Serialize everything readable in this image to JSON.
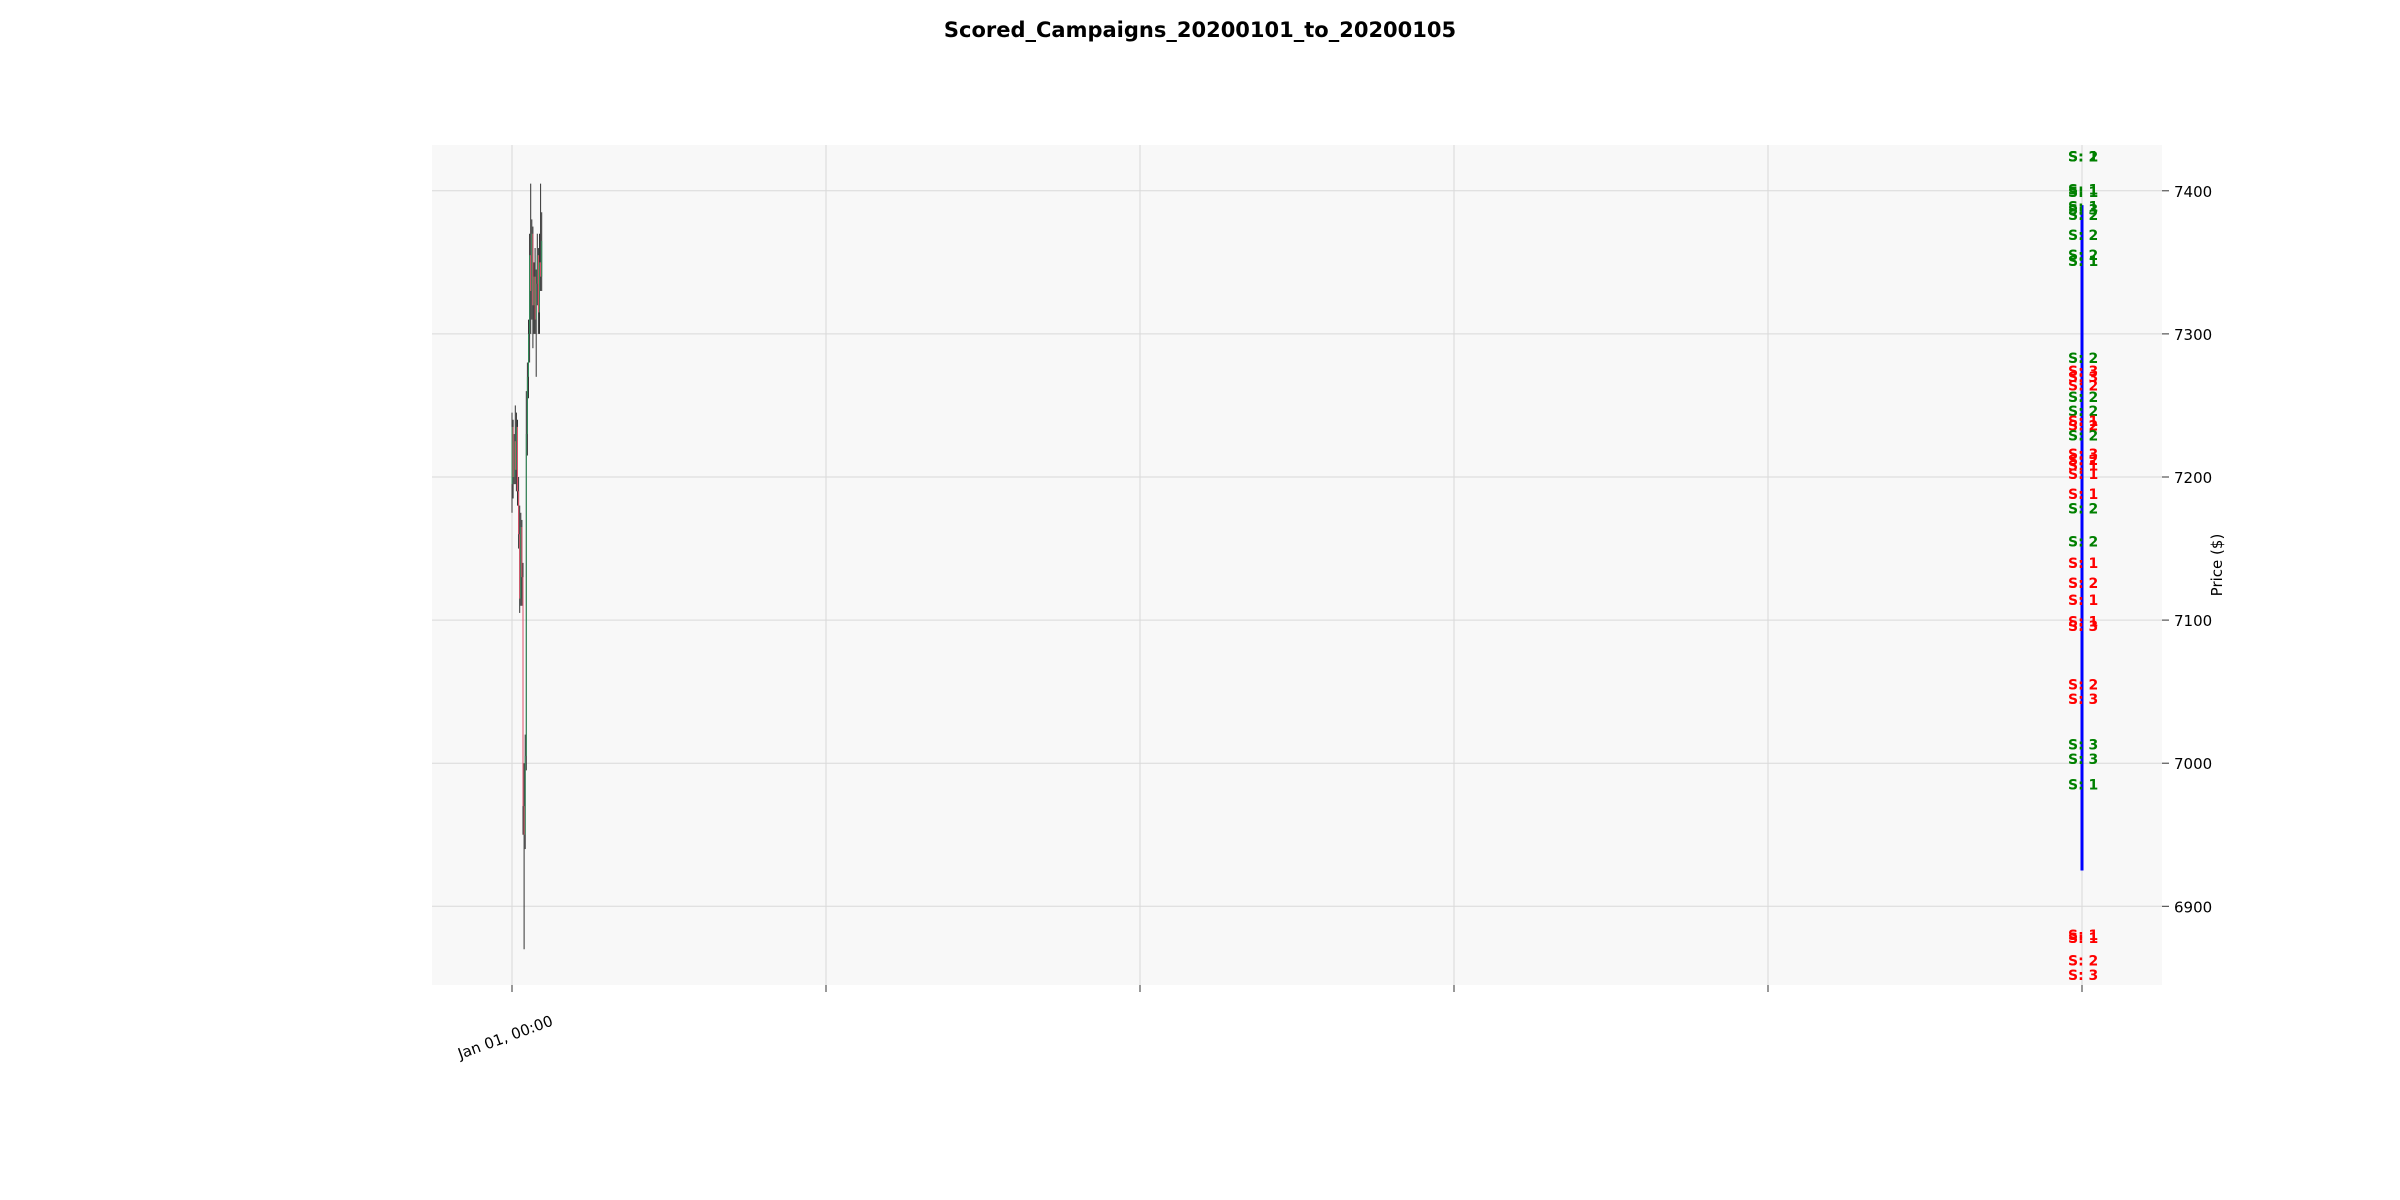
{
  "chart_data": {
    "type": "candlestick",
    "title": "Scored_Campaigns_20200101_to_20200105",
    "ylabel": "Price ($)",
    "xlabel": "",
    "x_tick_labels": [
      "Jan 01, 00:00",
      "",
      "",
      "",
      "",
      ""
    ],
    "ylim": [
      6845,
      7432
    ],
    "y_ticks": [
      6900,
      7000,
      7100,
      7200,
      7300,
      7400
    ],
    "grid": true,
    "colors": {
      "up": "#2e8b57",
      "down": "#e0506a",
      "wick": "#333333",
      "buy": "#008000",
      "sell": "#ff0000",
      "line": "#0000ff",
      "plot_bg": "#f8f8f8",
      "grid": "#d9d9d9"
    },
    "candles": [
      {
        "o": 7195,
        "h": 7245,
        "l": 7175,
        "c": 7235
      },
      {
        "o": 7235,
        "h": 7240,
        "l": 7185,
        "c": 7200
      },
      {
        "o": 7200,
        "h": 7230,
        "l": 7195,
        "c": 7225
      },
      {
        "o": 7225,
        "h": 7250,
        "l": 7195,
        "c": 7205
      },
      {
        "o": 7205,
        "h": 7245,
        "l": 7190,
        "c": 7235
      },
      {
        "o": 7235,
        "h": 7240,
        "l": 7180,
        "c": 7190
      },
      {
        "o": 7190,
        "h": 7200,
        "l": 7150,
        "c": 7160
      },
      {
        "o": 7160,
        "h": 7180,
        "l": 7105,
        "c": 7115
      },
      {
        "o": 7115,
        "h": 7175,
        "l": 7110,
        "c": 7165
      },
      {
        "o": 7165,
        "h": 7170,
        "l": 7110,
        "c": 7130
      },
      {
        "o": 7130,
        "h": 7140,
        "l": 6950,
        "c": 6970
      },
      {
        "o": 6970,
        "h": 7000,
        "l": 6870,
        "c": 6950
      },
      {
        "o": 6950,
        "h": 7020,
        "l": 6940,
        "c": 7005
      },
      {
        "o": 7005,
        "h": 7260,
        "l": 6995,
        "c": 7230
      },
      {
        "o": 7230,
        "h": 7280,
        "l": 7215,
        "c": 7270
      },
      {
        "o": 7270,
        "h": 7310,
        "l": 7255,
        "c": 7300
      },
      {
        "o": 7300,
        "h": 7370,
        "l": 7280,
        "c": 7355
      },
      {
        "o": 7355,
        "h": 7405,
        "l": 7300,
        "c": 7330
      },
      {
        "o": 7330,
        "h": 7380,
        "l": 7310,
        "c": 7370
      },
      {
        "o": 7370,
        "h": 7375,
        "l": 7290,
        "c": 7320
      },
      {
        "o": 7320,
        "h": 7350,
        "l": 7300,
        "c": 7340
      },
      {
        "o": 7340,
        "h": 7360,
        "l": 7300,
        "c": 7310
      },
      {
        "o": 7310,
        "h": 7345,
        "l": 7270,
        "c": 7335
      },
      {
        "o": 7335,
        "h": 7370,
        "l": 7320,
        "c": 7355
      },
      {
        "o": 7355,
        "h": 7360,
        "l": 7300,
        "c": 7315
      },
      {
        "o": 7315,
        "h": 7370,
        "l": 7300,
        "c": 7350
      },
      {
        "o": 7350,
        "h": 7405,
        "l": 7330,
        "c": 7340
      },
      {
        "o": 7340,
        "h": 7385,
        "l": 7330,
        "c": 7365
      }
    ],
    "vertical_line": {
      "from": 6925,
      "to": 7390
    },
    "labels": [
      {
        "text": "S: 2",
        "price": 7424,
        "side": "buy"
      },
      {
        "text": "S: 1",
        "price": 7424,
        "side": "buy"
      },
      {
        "text": "S: 1",
        "price": 7401,
        "side": "buy"
      },
      {
        "text": "S: 1",
        "price": 7399,
        "side": "buy"
      },
      {
        "text": "S: 1",
        "price": 7389,
        "side": "buy"
      },
      {
        "text": "S: 3",
        "price": 7387,
        "side": "buy"
      },
      {
        "text": "S: 2",
        "price": 7383,
        "side": "buy"
      },
      {
        "text": "S: 2",
        "price": 7369,
        "side": "buy"
      },
      {
        "text": "S: 2",
        "price": 7355,
        "side": "buy"
      },
      {
        "text": "S: 1",
        "price": 7351,
        "side": "buy"
      },
      {
        "text": "S: 2",
        "price": 7283,
        "side": "buy"
      },
      {
        "text": "S: 3",
        "price": 7274,
        "side": "sell"
      },
      {
        "text": "S: 3",
        "price": 7270,
        "side": "sell"
      },
      {
        "text": "S: 2",
        "price": 7264,
        "side": "sell"
      },
      {
        "text": "S: 2",
        "price": 7256,
        "side": "buy"
      },
      {
        "text": "S: 2",
        "price": 7246,
        "side": "buy"
      },
      {
        "text": "S: 1",
        "price": 7239,
        "side": "sell"
      },
      {
        "text": "S: 2",
        "price": 7236,
        "side": "sell"
      },
      {
        "text": "S: 2",
        "price": 7229,
        "side": "buy"
      },
      {
        "text": "S: 3",
        "price": 7216,
        "side": "sell"
      },
      {
        "text": "S: 2",
        "price": 7212,
        "side": "sell"
      },
      {
        "text": "S: 1",
        "price": 7208,
        "side": "sell"
      },
      {
        "text": "S: 1",
        "price": 7202,
        "side": "sell"
      },
      {
        "text": "S: 1",
        "price": 7188,
        "side": "sell"
      },
      {
        "text": "S: 2",
        "price": 7178,
        "side": "buy"
      },
      {
        "text": "S: 2",
        "price": 7155,
        "side": "buy"
      },
      {
        "text": "S: 1",
        "price": 7140,
        "side": "sell"
      },
      {
        "text": "S: 2",
        "price": 7126,
        "side": "sell"
      },
      {
        "text": "S: 1",
        "price": 7099,
        "side": "sell"
      },
      {
        "text": "S: 3",
        "price": 7096,
        "side": "sell"
      },
      {
        "text": "S: 1",
        "price": 7114,
        "side": "sell"
      },
      {
        "text": "S: 2",
        "price": 7055,
        "side": "sell"
      },
      {
        "text": "S: 3",
        "price": 7045,
        "side": "sell"
      },
      {
        "text": "S: 3",
        "price": 7013,
        "side": "buy"
      },
      {
        "text": "S: 3",
        "price": 7003,
        "side": "buy"
      },
      {
        "text": "S: 1",
        "price": 6985,
        "side": "buy"
      },
      {
        "text": "S: 1",
        "price": 6880,
        "side": "sell"
      },
      {
        "text": "S: 1",
        "price": 6878,
        "side": "sell"
      },
      {
        "text": "S: 2",
        "price": 6862,
        "side": "sell"
      },
      {
        "text": "S: 3",
        "price": 6852,
        "side": "sell"
      }
    ]
  }
}
